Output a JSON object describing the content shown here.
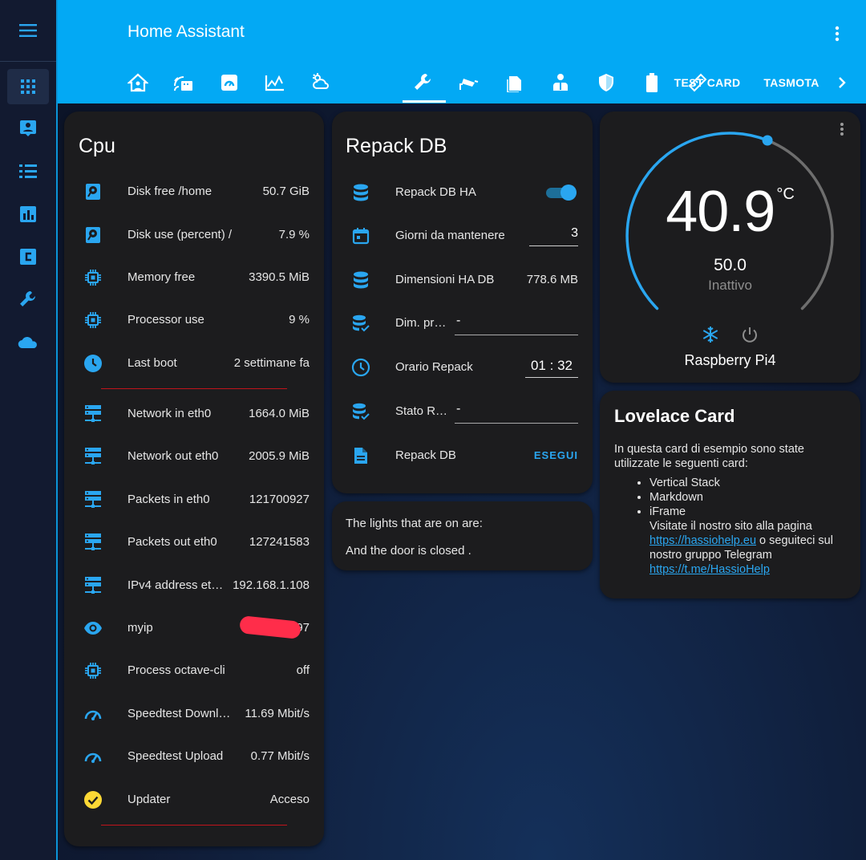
{
  "header": {
    "title": "Home Assistant",
    "tabs_icons": [
      "home-user-icon",
      "router-icon",
      "dashboard-icon",
      "chart-line-icon",
      "weather-cloud-icon",
      "wrench-icon",
      "cctv-icon",
      "lightning-box-icon",
      "person-icon",
      "shield-icon",
      "battery-icon",
      "tape-measure-icon"
    ],
    "tab_test_card": "TEST CARD",
    "tab_tasmota": "TASMOTA"
  },
  "sidebar": {
    "items": [
      "grid-icon",
      "account-box-icon",
      "list-icon",
      "bar-chart-icon",
      "letter-c-icon",
      "wrench-icon",
      "cloud-icon"
    ]
  },
  "cpu_card": {
    "title": "Cpu",
    "rows": [
      {
        "label": "Disk free /home",
        "value": "50.7 GiB",
        "icon": "harddisk-icon"
      },
      {
        "label": "Disk use (percent) /",
        "value": "7.9 %",
        "icon": "harddisk-icon"
      },
      {
        "label": "Memory free",
        "value": "3390.5 MiB",
        "icon": "chip-icon"
      },
      {
        "label": "Processor use",
        "value": "9 %",
        "icon": "chip-icon"
      },
      {
        "label": "Last boot",
        "value": "2 settimane fa",
        "icon": "clock-icon"
      },
      {
        "label": "Network in eth0",
        "value": "1664.0 MiB",
        "icon": "server-network-icon"
      },
      {
        "label": "Network out eth0",
        "value": "2005.9 MiB",
        "icon": "server-network-icon"
      },
      {
        "label": "Packets in eth0",
        "value": "121700927",
        "icon": "server-network-icon"
      },
      {
        "label": "Packets out eth0",
        "value": "127241583",
        "icon": "server-network-icon"
      },
      {
        "label": "IPv4 address et…",
        "value": "192.168.1.108",
        "icon": "server-network-icon"
      },
      {
        "label": "myip",
        "value": "97",
        "icon": "eye-icon"
      },
      {
        "label": "Process octave-cli",
        "value": "off",
        "icon": "chip-icon"
      },
      {
        "label": "Speedtest Downl…",
        "value": "11.69 Mbit/s",
        "icon": "speedometer-icon"
      },
      {
        "label": "Speedtest Upload",
        "value": "0.77 Mbit/s",
        "icon": "speedometer-icon"
      },
      {
        "label": "Updater",
        "value": "Acceso",
        "icon": "check-circle-icon"
      }
    ]
  },
  "repack_card": {
    "title": "Repack DB",
    "repack_ha_label": "Repack DB HA",
    "repack_ha_on": true,
    "giorni_label": "Giorni da mantenere",
    "giorni_value": "3",
    "dimensioni_label": "Dimensioni HA DB",
    "dimensioni_value": "778.6 MB",
    "dim_pr_label": "Dim. pr…",
    "dim_pr_value": "-",
    "orario_label": "Orario Repack",
    "orario_hh": "01",
    "orario_sep": ":",
    "orario_mm": "32",
    "stato_label": "Stato R…",
    "stato_value": "-",
    "repack_db_label": "Repack DB",
    "esegui_label": "ESEGUI"
  },
  "markdown_card": {
    "line1": "The lights that are on are:",
    "line2": "And the door is closed ."
  },
  "thermostat_card": {
    "current_temp": "40.9",
    "unit": "°C",
    "target": "50.0",
    "state": "Inattivo",
    "name": "Raspberry Pi4",
    "target_fraction": 0.58
  },
  "lovelace_card": {
    "title": "Lovelace Card",
    "intro": "In questa card di esempio sono state utilizzate le seguenti card:",
    "bullets": [
      "Vertical Stack",
      "Markdown",
      "iFrame"
    ],
    "visit_text": "Visitate il nostro sito alla pagina",
    "link1": "https://hassiohelp.eu",
    "follow_text": "o seguiteci sul nostro gruppo Telegram",
    "link2": "https://t.me/HassioHelp"
  },
  "colors": {
    "accent": "#03a9f4",
    "card": "#1c1c1e",
    "icon_blue": "#2aa6f0",
    "updater_yellow": "#fdd835",
    "myip_redaction": "#ff2d4a"
  }
}
